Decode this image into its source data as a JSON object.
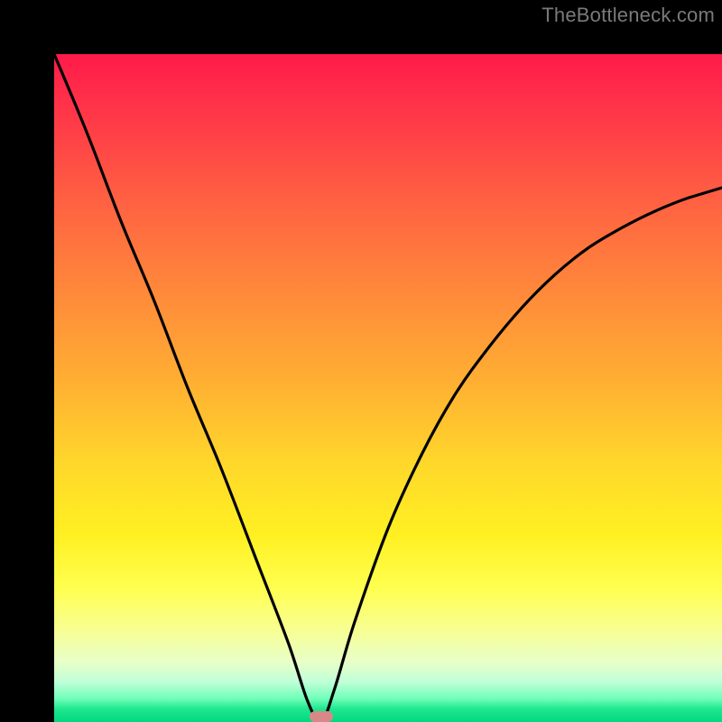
{
  "watermark": "TheBottleneck.com",
  "chart_data": {
    "type": "line",
    "title": "",
    "xlabel": "",
    "ylabel": "",
    "xlim": [
      0,
      100
    ],
    "ylim": [
      0,
      100
    ],
    "grid": false,
    "legend": false,
    "background": "rainbow-gradient (red top → green bottom)",
    "marker": {
      "x": 40,
      "y": 0,
      "color": "#d98888"
    },
    "series": [
      {
        "name": "bottleneck-curve",
        "color": "#000000",
        "x": [
          0,
          5,
          10,
          15,
          20,
          25,
          30,
          35,
          38,
          40,
          42,
          45,
          50,
          55,
          60,
          65,
          70,
          75,
          80,
          85,
          90,
          95,
          100
        ],
        "y": [
          100,
          88,
          75,
          63,
          50,
          38,
          25,
          12,
          3,
          0,
          5,
          15,
          29,
          40,
          49,
          56,
          62,
          67,
          71,
          74,
          76.5,
          78.5,
          80
        ]
      }
    ]
  }
}
